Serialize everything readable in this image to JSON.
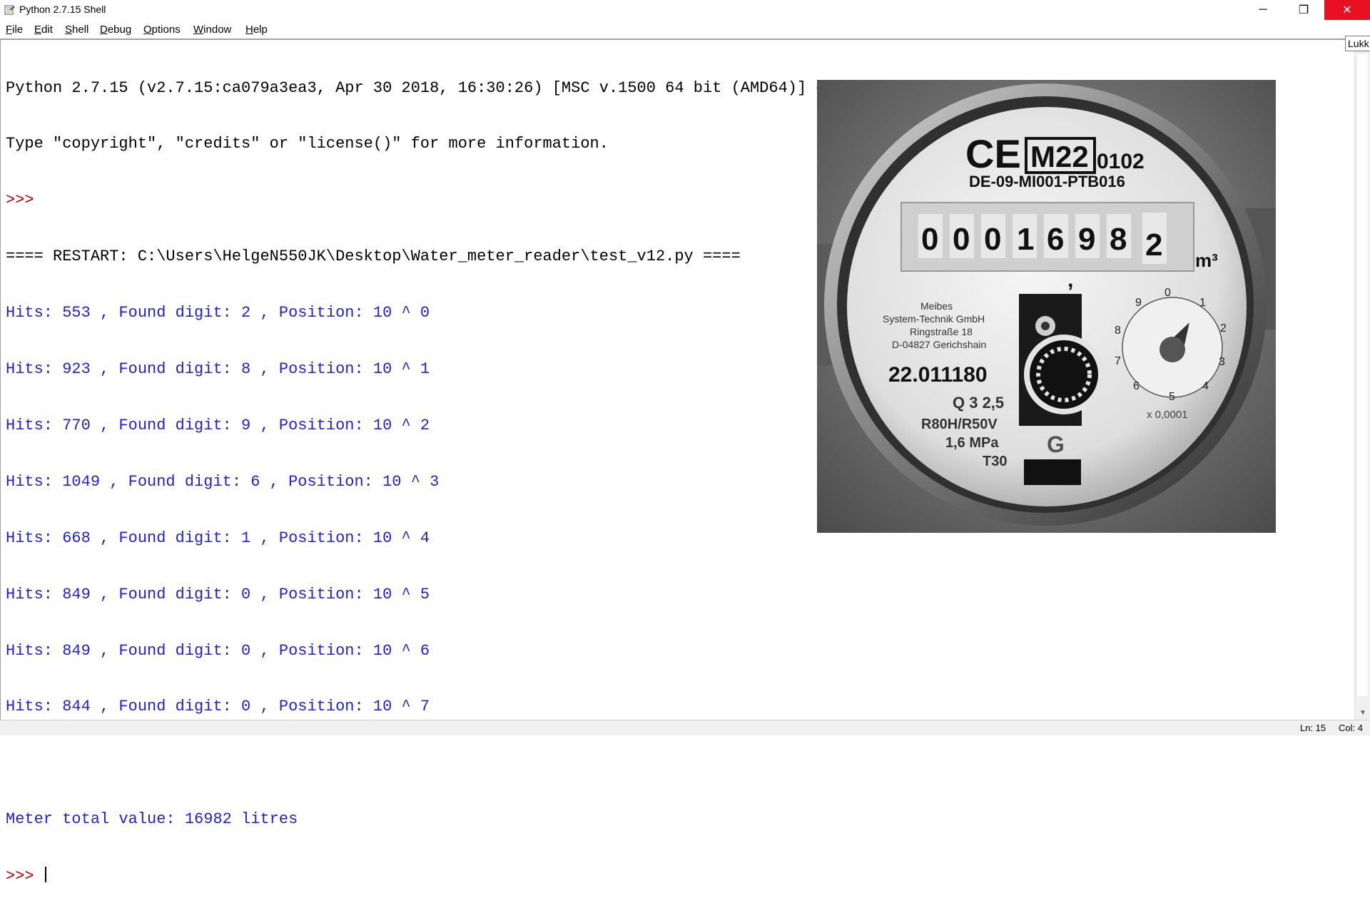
{
  "window": {
    "title": "Python 2.7.15 Shell",
    "minimize_glyph": "─",
    "maximize_glyph": "❐",
    "close_glyph": "✕"
  },
  "menu": [
    "File",
    "Edit",
    "Shell",
    "Debug",
    "Options",
    "Window",
    "Help"
  ],
  "shell": {
    "lines": [
      {
        "text": "Python 2.7.15 (v2.7.15:ca079a3ea3, Apr 30 2018, 16:30:26) [MSC v.1500 64 bit (AMD64)] on win32",
        "color": "black"
      },
      {
        "text": "Type \"copyright\", \"credits\" or \"license()\" for more information.",
        "color": "black"
      },
      {
        "text": ">>> ",
        "color": "red"
      },
      {
        "text": "==== RESTART: C:\\Users\\HelgeN550JK\\Desktop\\Water_meter_reader\\test_v12.py ====",
        "color": "black"
      },
      {
        "text": "Hits: 553 , Found digit: 2 , Position: 10 ^ 0",
        "color": "blue"
      },
      {
        "text": "Hits: 923 , Found digit: 8 , Position: 10 ^ 1",
        "color": "blue"
      },
      {
        "text": "Hits: 770 , Found digit: 9 , Position: 10 ^ 2",
        "color": "blue"
      },
      {
        "text": "Hits: 1049 , Found digit: 6 , Position: 10 ^ 3",
        "color": "blue"
      },
      {
        "text": "Hits: 668 , Found digit: 1 , Position: 10 ^ 4",
        "color": "blue"
      },
      {
        "text": "Hits: 849 , Found digit: 0 , Position: 10 ^ 5",
        "color": "blue"
      },
      {
        "text": "Hits: 849 , Found digit: 0 , Position: 10 ^ 6",
        "color": "blue"
      },
      {
        "text": "Hits: 844 , Found digit: 0 , Position: 10 ^ 7",
        "color": "blue"
      },
      {
        "text": "",
        "color": "blue"
      },
      {
        "text": "Meter total value: 16982 litres",
        "color": "blue"
      }
    ],
    "prompt": ">>> "
  },
  "tooltip": "Lukk",
  "status": {
    "line": "Ln: 15",
    "col": "Col: 4"
  },
  "meter": {
    "marks": [
      "CE",
      "M22",
      "0102"
    ],
    "approval": "DE-09-MI001-PTB016",
    "drum_digits": [
      "0",
      "0",
      "0",
      "1",
      "6",
      "9",
      "8",
      "2"
    ],
    "unit": "m³",
    "manufacturer": [
      "Meibes",
      "System-Technik GmbH",
      "Ringstraße 18",
      "D-04827 Gerichshain"
    ],
    "serial": "22.011180",
    "flow": "Q 3 2,5",
    "ratio": "R80H/R50V",
    "pressure": "1,6 MPa",
    "temp": "T30",
    "dial_numbers": [
      "0",
      "1",
      "2",
      "3",
      "4",
      "5",
      "6",
      "7",
      "8",
      "9"
    ],
    "dial_factor": "x 0,0001"
  },
  "colors": {
    "prompt": "#c00000",
    "output": "#1f1fd8",
    "close_button": "#e81123"
  }
}
